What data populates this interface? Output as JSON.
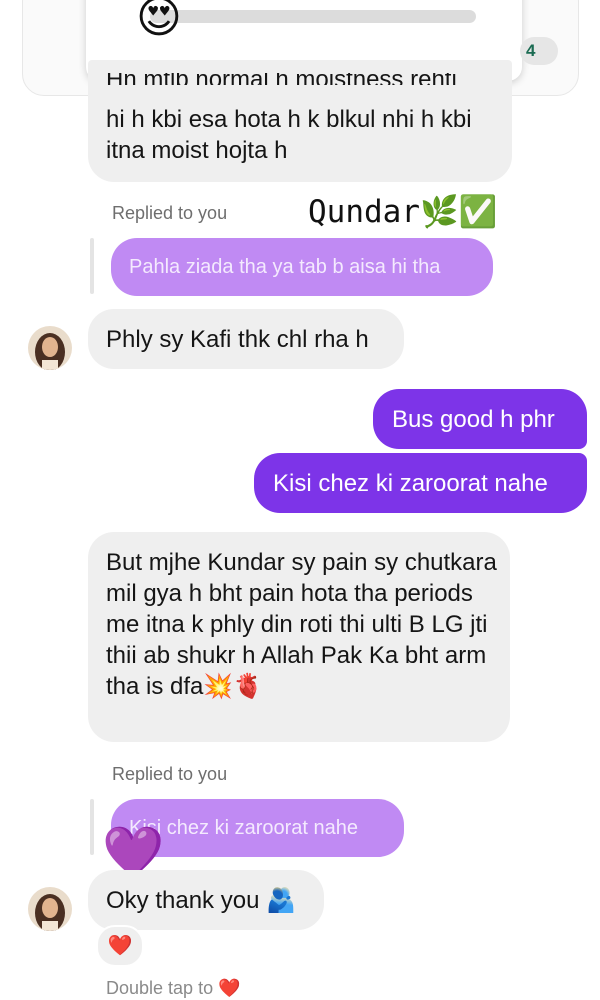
{
  "top_card": {
    "emoji": "😍",
    "count": "4"
  },
  "messages": {
    "m1_partial": "hi h kbi esa hota h k blkul nhi h kbi itna moist hojta h",
    "m1_cut_line": "Hn mtlb normal h moistness rehti",
    "replied_label_1": "Replied to you",
    "overlay_caption": "Qundar🌿✅",
    "reply_quote_1": "Pahla ziada tha ya tab b aisa hi tha",
    "m2": "Phly sy Kafi thk chl rha h",
    "out1": "Bus good h phr",
    "out2": "Kisi chez ki zaroorat nahe",
    "m3": "But mjhe Kundar sy pain sy chutkara mil gya h bht pain hota tha periods me itna k phly din roti thi ulti B LG jti thii ab shukr h Allah Pak Ka bht arm tha is dfa💥🫀",
    "replied_label_2": "Replied to you",
    "reply_quote_2": "Kisi chez ki zaroorat nahe",
    "heart_sticker": "💜",
    "m4": "Oky thank you 🫂",
    "reaction": "❤️",
    "footer_hint": "Double tap to ❤️"
  },
  "colors": {
    "outgoing": "#7d34e8",
    "reply_quote": "#c08af3",
    "incoming": "#efefef"
  }
}
